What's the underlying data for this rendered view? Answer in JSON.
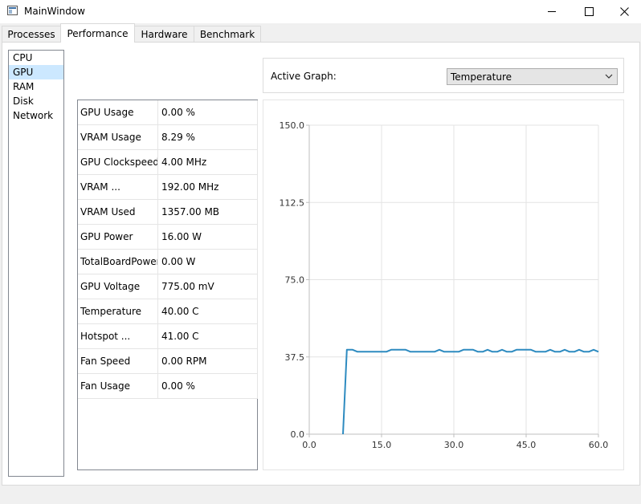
{
  "window": {
    "title": "MainWindow"
  },
  "tabs": [
    {
      "label": "Processes"
    },
    {
      "label": "Performance"
    },
    {
      "label": "Hardware"
    },
    {
      "label": "Benchmark"
    }
  ],
  "nav": [
    {
      "label": "CPU"
    },
    {
      "label": "GPU"
    },
    {
      "label": "RAM"
    },
    {
      "label": "Disk"
    },
    {
      "label": "Network"
    }
  ],
  "stats": [
    {
      "key": "GPU Usage",
      "value": "0.00 %"
    },
    {
      "key": "VRAM Usage",
      "value": "8.29 %"
    },
    {
      "key": "GPU Clockspeed",
      "value": "4.00 MHz"
    },
    {
      "key": "VRAM ...",
      "value": "192.00 MHz"
    },
    {
      "key": "VRAM Used",
      "value": "1357.00 MB"
    },
    {
      "key": "GPU Power",
      "value": "16.00 W"
    },
    {
      "key": "TotalBoardPower",
      "value": "0.00 W"
    },
    {
      "key": "GPU Voltage",
      "value": "775.00 mV"
    },
    {
      "key": "Temperature",
      "value": "40.00 C"
    },
    {
      "key": "Hotspot ...",
      "value": "41.00 C"
    },
    {
      "key": "Fan Speed",
      "value": "0.00 RPM"
    },
    {
      "key": "Fan Usage",
      "value": "0.00 %"
    }
  ],
  "graph": {
    "label": "Active Graph:",
    "selected": "Temperature"
  },
  "chart_data": {
    "type": "line",
    "xlim": [
      0,
      60
    ],
    "ylim": [
      0,
      150
    ],
    "x_ticks": [
      0,
      15,
      30,
      45,
      60
    ],
    "y_ticks": [
      0,
      37.5,
      75,
      112.5,
      150
    ],
    "x_tick_labels": [
      "0.0",
      "15.0",
      "30.0",
      "45.0",
      "60.0"
    ],
    "y_tick_labels": [
      "0.0",
      "37.5",
      "75.0",
      "112.5",
      "150.0"
    ],
    "grid": true,
    "color": "#2e8bc0",
    "series": [
      {
        "x": [
          7,
          7.8,
          9,
          10,
          11,
          12,
          13,
          14,
          15,
          16,
          17,
          18,
          19,
          20,
          21,
          22,
          23,
          24,
          25,
          26,
          27,
          28,
          29,
          30,
          31,
          32,
          33,
          34,
          35,
          36,
          37,
          38,
          39,
          40,
          41,
          42,
          43,
          44,
          45,
          46,
          47,
          48,
          49,
          50,
          51,
          52,
          53,
          54,
          55,
          56,
          57,
          58,
          59,
          60
        ],
        "y": [
          0,
          41,
          41,
          40,
          40,
          40,
          40,
          40,
          40,
          40,
          41,
          41,
          41,
          41,
          40,
          40,
          40,
          40,
          40,
          40,
          41,
          40,
          40,
          40,
          40,
          41,
          41,
          41,
          40,
          40,
          41,
          40,
          40,
          41,
          40,
          40,
          41,
          41,
          41,
          41,
          40,
          40,
          40,
          41,
          40,
          40,
          41,
          40,
          40,
          41,
          40,
          40,
          41,
          40
        ]
      }
    ]
  }
}
